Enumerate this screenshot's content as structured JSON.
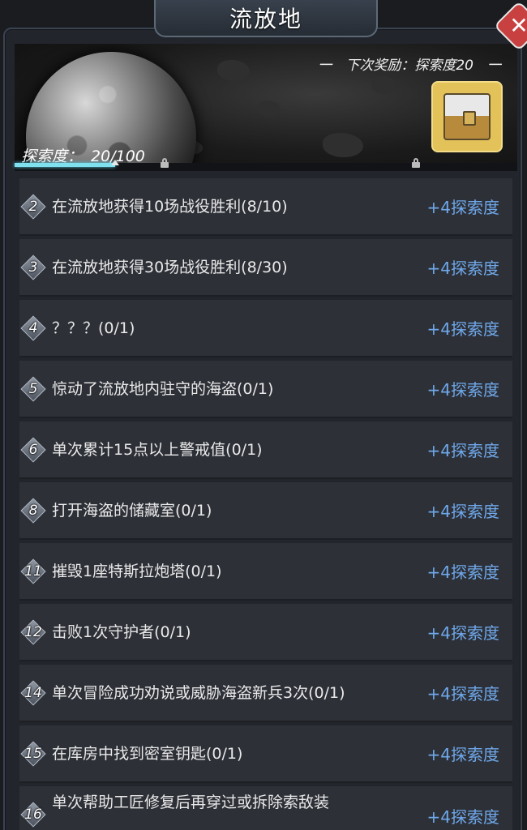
{
  "title": "流放地",
  "close_icon": "close-icon",
  "next_reward": "一　下次奖励：探索度20　一",
  "explore": {
    "label": "探索度：",
    "current": "20",
    "max": "/100",
    "progress": 0.2
  },
  "reward_chest_icon": "treasure-chest-icon",
  "tasks": [
    {
      "num": "2",
      "text": "在流放地获得10场战役胜利(8/10)",
      "reward": "+4探索度"
    },
    {
      "num": "3",
      "text": "在流放地获得30场战役胜利(8/30)",
      "reward": "+4探索度"
    },
    {
      "num": "4",
      "text": "？？？(0/1)",
      "reward": "+4探索度"
    },
    {
      "num": "5",
      "text": "惊动了流放地内驻守的海盗(0/1)",
      "reward": "+4探索度"
    },
    {
      "num": "6",
      "text": "单次累计15点以上警戒值(0/1)",
      "reward": "+4探索度"
    },
    {
      "num": "8",
      "text": "打开海盗的储藏室(0/1)",
      "reward": "+4探索度"
    },
    {
      "num": "11",
      "text": "摧毁1座特斯拉炮塔(0/1)",
      "reward": "+4探索度"
    },
    {
      "num": "12",
      "text": "击败1次守护者(0/1)",
      "reward": "+4探索度"
    },
    {
      "num": "14",
      "text": "单次冒险成功劝说或威胁海盗新兵3次(0/1)",
      "reward": "+4探索度"
    },
    {
      "num": "15",
      "text": "在库房中找到密室钥匙(0/1)",
      "reward": "+4探索度"
    },
    {
      "num": "16",
      "text": "单次帮助工匠修复后再穿过或拆除索敌装",
      "reward": "+4探索度"
    }
  ],
  "colors": {
    "reward_text": "#6fa8ea",
    "progress_fill": "#7fe0f0",
    "close_button": "#c84040"
  }
}
